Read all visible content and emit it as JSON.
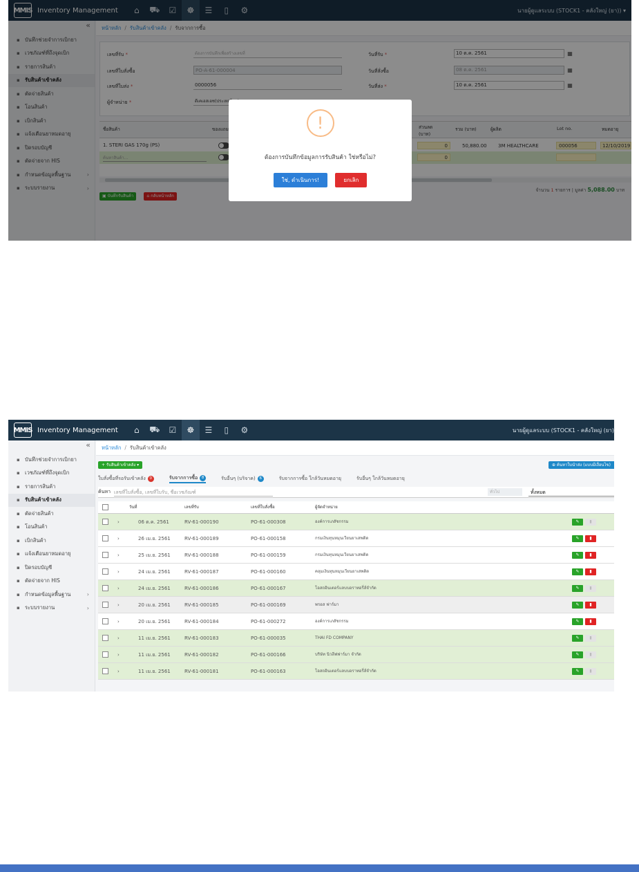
{
  "app": {
    "title": "Inventory Management",
    "logo_text": "MMIS",
    "nav_icons": [
      "home-icon",
      "cart-icon",
      "checklist-icon",
      "medicine-icon",
      "database-icon",
      "document-icon",
      "settings-icon"
    ],
    "nav_active_index": 3
  },
  "sidebar": {
    "collapse_glyph": "«",
    "items": [
      {
        "label": "บันทึกช่วยจำการเบิกยา",
        "icon": "note-icon"
      },
      {
        "label": "เวชภัณฑ์ที่ถึงจุดเบิก",
        "icon": "pill-icon"
      },
      {
        "label": "รายการสินค้า",
        "icon": "folder-icon"
      },
      {
        "label": "รับสินค้าเข้าคลัง",
        "icon": "plus-icon",
        "active": true
      },
      {
        "label": "ตัดจ่ายสินค้า",
        "icon": "scissors-icon"
      },
      {
        "label": "โอนสินค้า",
        "icon": "transfer-icon"
      },
      {
        "label": "เบิกสินค้า",
        "icon": "box-icon"
      },
      {
        "label": "แจ้งเตือนยาหมดอายุ",
        "icon": "alarm-icon"
      },
      {
        "label": "ปิดรอบบัญชี",
        "icon": "check-circle-icon"
      },
      {
        "label": "ตัดจ่ายจาก HIS",
        "icon": "sync-icon"
      },
      {
        "label": "กำหนดข้อมูลพื้นฐาน",
        "icon": "gear-icon",
        "chevron": "›"
      },
      {
        "label": "ระบบรายงาน",
        "icon": "report-icon",
        "chevron": "›"
      }
    ]
  },
  "shot1": {
    "user_label": "นายผู้ดูแลระบบ (STOCK1 - คลังใหญ่ (ยา)) ▾",
    "breadcrumb": [
      "หน้าหลัก",
      "รับสินค้าเข้าคลัง",
      "รับจากการซื้อ"
    ],
    "form": {
      "receipt_no_label": "เลขที่รับ",
      "receipt_no_placeholder": "ต้องการบันทึกเพื่อสร้างเลขที่",
      "po_no_label": "เลขที่ใบสั่งซื้อ",
      "po_no_value": "PO-A-61-000004",
      "invoice_no_label": "เลขที่ใบส่ง",
      "invoice_no_value": "0000056",
      "vendor_label": "ผู้จำหน่าย",
      "vendor_value": "ดีเคเอสเอช(ประเทศไทย)",
      "receive_date_label": "วันที่รับ",
      "receive_date_value": "10 ต.ค. 2561",
      "order_date_label": "วันที่สั่งซื้อ",
      "order_date_value": "08 ต.ค. 2561",
      "delivery_date_label": "วันที่ส่ง",
      "delivery_date_value": "10 ต.ค. 2561",
      "required_mark": "*",
      "calendar_glyph": "▦"
    },
    "grid": {
      "headers": [
        "ชื่อสินค้า",
        "ของแถม",
        "ส่วนลด (บาท)",
        "รวม (บาท)",
        "ผู้ผลิต",
        "Lot no.",
        "หมดอายุ"
      ],
      "row1": {
        "name": "1. STERI GAS 170g (PS)",
        "discount": "0",
        "total": "50,880.00",
        "manufacturer": "3M HEALTHCARE",
        "lot": "000056",
        "expiry": "12/10/2019"
      },
      "row2": {
        "name_placeholder": "ค้นหาสินค้า...",
        "discount": "0"
      }
    },
    "buttons": {
      "save": "บันทึกรับสินค้า",
      "back": "กลับหน้าหลัก"
    },
    "summary": {
      "prefix": "จำนวน",
      "count": "1",
      "mid": "รายการ | มูลค่า",
      "amount": "5,088.00",
      "unit": "บาท"
    },
    "modal": {
      "icon_glyph": "!",
      "message": "ต้องการบันทึกข้อมูลการรับสินค้า ใช่หรือไม่?",
      "confirm": "ใช่, ดำเนินการ!",
      "cancel": "ยกเลิก"
    }
  },
  "shot2": {
    "user_label": "นายผู้ดูแลระบบ (STOCK1 - คลังใหญ่ (ยา)",
    "breadcrumb": [
      "หน้าหลัก",
      "รับสินค้าเข้าคลัง"
    ],
    "add_button": "+ รับสินค้าเข้าคลัง ▾",
    "right_button": "⊕ ค้นหาใบนำส่ง (แบบมีเงื่อนไข)",
    "tabs": [
      {
        "label": "ใบสั่งซื้อที่รอรับเข้าคลัง",
        "badge": "0",
        "badge_color": "#d9342b"
      },
      {
        "label": "รับจากการซื้อ",
        "badge": "8",
        "badge_color": "#1e88c8",
        "active": true
      },
      {
        "label": "รับอื่นๆ (บริจาค)",
        "badge": "6",
        "badge_color": "#1e88c8"
      },
      {
        "label": "รับจากการซื้อ ใกล้วันหมดอายุ"
      },
      {
        "label": "รับอื่นๆ ใกล้วันหมดอายุ"
      }
    ],
    "search": {
      "label": "ค้นหา",
      "placeholder": "เลขที่ใบสั่งซื้อ, เลขที่ใบรับ, ชื่อเวชภัณฑ์",
      "filter_placeholder": "ทั่วไป",
      "filter_value": "ทั้งหมด"
    },
    "columns": [
      "วันที่",
      "เลขที่รับ",
      "เลขที่ใบสั่งซื้อ",
      "ผู้จัดจำหน่าย"
    ],
    "rows": [
      {
        "date": "06 ต.ค. 2561",
        "rv": "RV-61-000190",
        "po": "PO-61-000308",
        "vendor": "องค์การเภสัชกรรม",
        "style": "g",
        "del": false
      },
      {
        "date": "26 เม.ย. 2561",
        "rv": "RV-61-000189",
        "po": "PO-61-000158",
        "vendor": "กรมเงินทุนหมุนเวียนยาเสพติด",
        "style": "w",
        "del": true
      },
      {
        "date": "25 เม.ย. 2561",
        "rv": "RV-61-000188",
        "po": "PO-61-000159",
        "vendor": "กรมเงินทุนหมุนเวียนยาเสพติด",
        "style": "w",
        "del": true
      },
      {
        "date": "24 เม.ย. 2561",
        "rv": "RV-61-000187",
        "po": "PO-61-000160",
        "vendor": "คลุมเงินทุนหมุนเวียนยาเสพติด",
        "style": "w",
        "del": true
      },
      {
        "date": "24 เม.ย. 2561",
        "rv": "RV-61-000186",
        "po": "PO-61-000167",
        "vendor": "โอสถอินเตอร์แลบบอราทอรี่ส์จำกัด",
        "style": "g",
        "del": false
      },
      {
        "date": "20 เม.ย. 2561",
        "rv": "RV-61-000185",
        "po": "PO-61-000169",
        "vendor": "พรอส ฟาร์มา",
        "style": "gr",
        "del": true
      },
      {
        "date": "20 เม.ย. 2561",
        "rv": "RV-61-000184",
        "po": "PO-61-000272",
        "vendor": "องค์การเภสัชกรรม",
        "style": "w",
        "del": true
      },
      {
        "date": "11 เม.ย. 2561",
        "rv": "RV-61-000183",
        "po": "PO-61-000035",
        "vendor": "THAI FD COMPANY",
        "style": "g",
        "del": false
      },
      {
        "date": "11 เม.ย. 2561",
        "rv": "RV-61-000182",
        "po": "PO-61-000166",
        "vendor": "บริษัท นิวลีฟฟาร์มา จำกัด",
        "style": "g",
        "del": false
      },
      {
        "date": "11 เม.ย. 2561",
        "rv": "RV-61-000181",
        "po": "PO-61-000163",
        "vendor": "โอสถอินเตอร์แลบบอราทอรี่ส์จำกัด",
        "style": "g",
        "del": false
      }
    ]
  },
  "colors": {
    "topbar": "#1c3447",
    "green": "#29a329",
    "red": "#e02424",
    "blue": "#1e88c8",
    "confirm": "#2c7fd8",
    "cancel": "#e02d2d",
    "footer_band": "#4472c4"
  }
}
